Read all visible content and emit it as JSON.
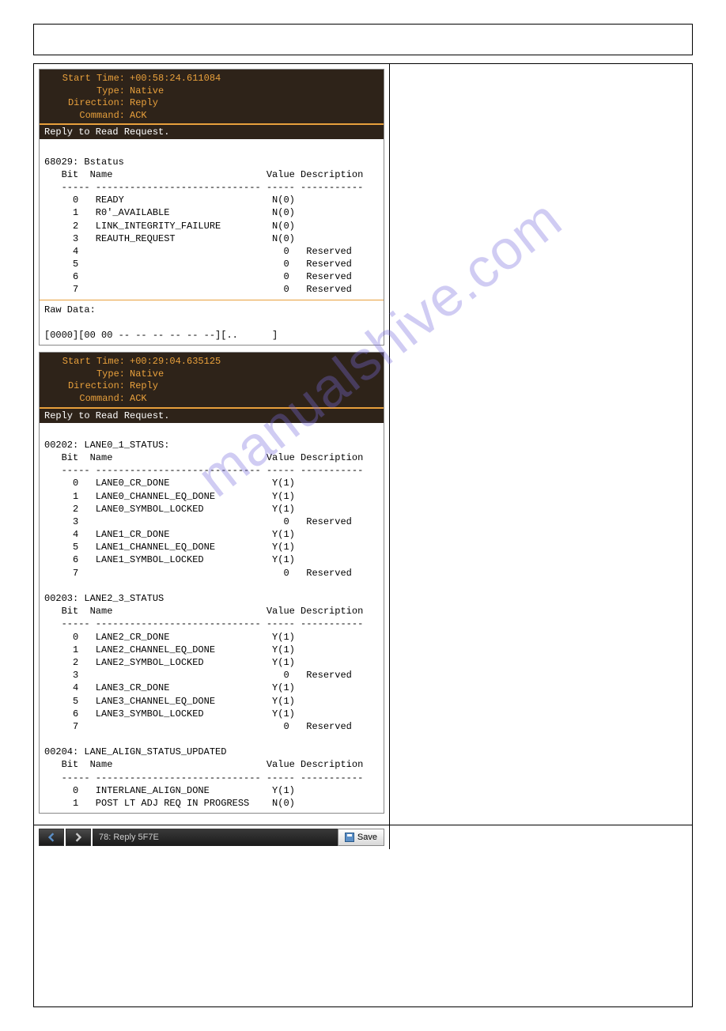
{
  "watermark": "manualshive.com",
  "panel1": {
    "hdr": [
      [
        "Start Time:",
        "+00:58:24.611084"
      ],
      [
        "Type:",
        "Native"
      ],
      [
        "Direction:",
        "Reply"
      ],
      [
        "Command:",
        "ACK"
      ]
    ],
    "sub": "Reply to Read Request.",
    "body1": "\n68029: Bstatus\n   Bit  Name                           Value Description\n   ----- ----------------------------- ----- -----------\n     0   READY                          N(0)\n     1   R0'_AVAILABLE                  N(0)\n     2   LINK_INTEGRITY_FAILURE         N(0)\n     3   REAUTH_REQUEST                 N(0)\n     4                                    0   Reserved\n     5                                    0   Reserved\n     6                                    0   Reserved\n     7                                    0   Reserved",
    "body2": "Raw Data:\n\n[0000][00 00 -- -- -- -- -- --][..      ]"
  },
  "panel2": {
    "hdr": [
      [
        "Start Time:",
        "+00:29:04.635125"
      ],
      [
        "Type:",
        "Native"
      ],
      [
        "Direction:",
        "Reply"
      ],
      [
        "Command:",
        "ACK"
      ]
    ],
    "sub": "Reply to Read Request.",
    "body": "\n00202: LANE0_1_STATUS:\n   Bit  Name                           Value Description\n   ----- ----------------------------- ----- -----------\n     0   LANE0_CR_DONE                  Y(1)\n     1   LANE0_CHANNEL_EQ_DONE          Y(1)\n     2   LANE0_SYMBOL_LOCKED            Y(1)\n     3                                    0   Reserved\n     4   LANE1_CR_DONE                  Y(1)\n     5   LANE1_CHANNEL_EQ_DONE          Y(1)\n     6   LANE1_SYMBOL_LOCKED            Y(1)\n     7                                    0   Reserved\n\n00203: LANE2_3_STATUS\n   Bit  Name                           Value Description\n   ----- ----------------------------- ----- -----------\n     0   LANE2_CR_DONE                  Y(1)\n     1   LANE2_CHANNEL_EQ_DONE          Y(1)\n     2   LANE2_SYMBOL_LOCKED            Y(1)\n     3                                    0   Reserved\n     4   LANE3_CR_DONE                  Y(1)\n     5   LANE3_CHANNEL_EQ_DONE          Y(1)\n     6   LANE3_SYMBOL_LOCKED            Y(1)\n     7                                    0   Reserved\n\n00204: LANE_ALIGN_STATUS_UPDATED\n   Bit  Name                           Value Description\n   ----- ----------------------------- ----- -----------\n     0   INTERLANE_ALIGN_DONE           Y(1)\n     1   POST LT ADJ REQ IN PROGRESS    N(0)"
  },
  "nav": {
    "label": "78: Reply 5F7E",
    "save": "Save"
  }
}
